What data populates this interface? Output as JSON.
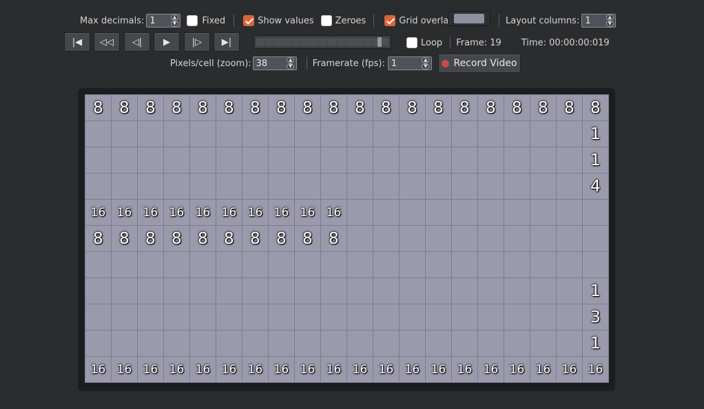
{
  "controls": {
    "max_decimals_label": "Max decimals:",
    "max_decimals_value": "1",
    "fixed_label": "Fixed",
    "fixed_checked": false,
    "show_values_label": "Show values",
    "show_values_checked": true,
    "zeroes_label": "Zeroes",
    "zeroes_checked": false,
    "grid_overlay_label": "Grid overlay",
    "grid_overlay_checked": true,
    "grid_overlay_color": "#8f909f",
    "layout_columns_label": "Layout columns:",
    "layout_columns_value": "1",
    "loop_label": "Loop",
    "loop_checked": false,
    "frame_text": "Frame: 19",
    "time_text": "Time: 00:00:00:019",
    "zoom_label": "Pixels/cell (zoom):",
    "zoom_value": "38",
    "framerate_label": "Framerate (fps):",
    "framerate_value": "1",
    "record_label": "Record Video",
    "timeline_position": 0.95
  },
  "transport": {
    "first_glyph": "|◀",
    "rewind_glyph": "◁◁",
    "step_back_glyph": "◁|",
    "play_glyph": "▶",
    "step_forward_glyph": "|▷",
    "last_glyph": "▶|"
  },
  "colors": {
    "accent": "#d9653b",
    "cell_fill": "#9a9aac",
    "record_dot": "#c94b4b"
  },
  "grid": {
    "columns": 20,
    "rows": [
      [
        "8",
        "8",
        "8",
        "8",
        "8",
        "8",
        "8",
        "8",
        "8",
        "8",
        "8",
        "8",
        "8",
        "8",
        "8",
        "8",
        "8",
        "8",
        "8",
        "8"
      ],
      [
        "",
        "",
        "",
        "",
        "",
        "",
        "",
        "",
        "",
        "",
        "",
        "",
        "",
        "",
        "",
        "",
        "",
        "",
        "",
        "1"
      ],
      [
        "",
        "",
        "",
        "",
        "",
        "",
        "",
        "",
        "",
        "",
        "",
        "",
        "",
        "",
        "",
        "",
        "",
        "",
        "",
        "1"
      ],
      [
        "",
        "",
        "",
        "",
        "",
        "",
        "",
        "",
        "",
        "",
        "",
        "",
        "",
        "",
        "",
        "",
        "",
        "",
        "",
        "4"
      ],
      [
        "16",
        "16",
        "16",
        "16",
        "16",
        "16",
        "16",
        "16",
        "16",
        "16",
        "",
        "",
        "",
        "",
        "",
        "",
        "",
        "",
        "",
        ""
      ],
      [
        "8",
        "8",
        "8",
        "8",
        "8",
        "8",
        "8",
        "8",
        "8",
        "8",
        "",
        "",
        "",
        "",
        "",
        "",
        "",
        "",
        "",
        ""
      ],
      [
        "",
        "",
        "",
        "",
        "",
        "",
        "",
        "",
        "",
        "",
        "",
        "",
        "",
        "",
        "",
        "",
        "",
        "",
        "",
        ""
      ],
      [
        "",
        "",
        "",
        "",
        "",
        "",
        "",
        "",
        "",
        "",
        "",
        "",
        "",
        "",
        "",
        "",
        "",
        "",
        "",
        "1"
      ],
      [
        "",
        "",
        "",
        "",
        "",
        "",
        "",
        "",
        "",
        "",
        "",
        "",
        "",
        "",
        "",
        "",
        "",
        "",
        "",
        "3"
      ],
      [
        "",
        "",
        "",
        "",
        "",
        "",
        "",
        "",
        "",
        "",
        "",
        "",
        "",
        "",
        "",
        "",
        "",
        "",
        "",
        "1"
      ],
      [
        "16",
        "16",
        "16",
        "16",
        "16",
        "16",
        "16",
        "16",
        "16",
        "16",
        "16",
        "16",
        "16",
        "16",
        "16",
        "16",
        "16",
        "16",
        "16",
        "16"
      ]
    ]
  }
}
